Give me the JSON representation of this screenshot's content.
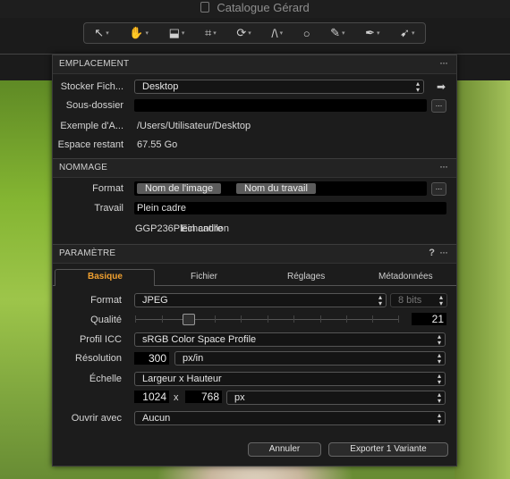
{
  "window": {
    "title": "Catalogue Gérard"
  },
  "toolbar": {
    "tools": [
      {
        "name": "pointer-tool",
        "glyph": "↖"
      },
      {
        "name": "pan-tool",
        "glyph": "✋"
      },
      {
        "name": "stamp-tool",
        "glyph": "⬓"
      },
      {
        "name": "crop-tool",
        "glyph": "⌗"
      },
      {
        "name": "rotate-tool",
        "glyph": "⟳"
      },
      {
        "name": "keystone-tool",
        "glyph": "/\\"
      },
      {
        "name": "ellipse-tool",
        "glyph": "○"
      },
      {
        "name": "brush-tool",
        "glyph": "✎"
      },
      {
        "name": "picker-tool",
        "glyph": "✒"
      },
      {
        "name": "annotate-tool",
        "glyph": "➹"
      }
    ],
    "dropdown": "▾"
  },
  "emplacement": {
    "header": "EMPLACEMENT",
    "more": "···",
    "store_label": "Stocker Fich...",
    "store_value": "Desktop",
    "subfolder_label": "Sous-dossier",
    "subfolder_value": "",
    "example_label": "Exemple d'A...",
    "example_value": "/Users/Utilisateur/Desktop",
    "space_label": "Espace restant",
    "space_value": "67.55 Go",
    "browse": "..."
  },
  "nommage": {
    "header": "NOMMAGE",
    "more": "···",
    "format_label": "Format",
    "tokens": [
      "Nom de l'image",
      "Nom du travail"
    ],
    "browse": "...",
    "job_label": "Travail",
    "job_value": "Plein cadre",
    "sample_label": "Echantillon",
    "sample_value": "GGP236Plein cadre"
  },
  "parametre": {
    "header": "PARAMÈTRE",
    "help": "?",
    "more": "···",
    "tabs": [
      "Basique",
      "Fichier",
      "Réglages",
      "Métadonnées"
    ],
    "format_label": "Format",
    "format_value": "JPEG",
    "bits_value": "8 bits",
    "quality_label": "Qualité",
    "quality_value": "21",
    "icc_label": "Profil ICC",
    "icc_value": "sRGB Color Space Profile",
    "resolution_label": "Résolution",
    "resolution_value": "300",
    "resolution_unit": "px/in",
    "scale_label": "Échelle",
    "scale_value": "Largeur x Hauteur",
    "width_value": "1024",
    "times": "x",
    "height_value": "768",
    "size_unit": "px",
    "open_label": "Ouvrir avec",
    "open_value": "Aucun"
  },
  "actions": {
    "cancel": "Annuler",
    "export": "Exporter 1 Variante"
  },
  "colors": {
    "accent": "#f0a030",
    "panel": "#1c1c1c",
    "photo_green": "#84b532"
  }
}
